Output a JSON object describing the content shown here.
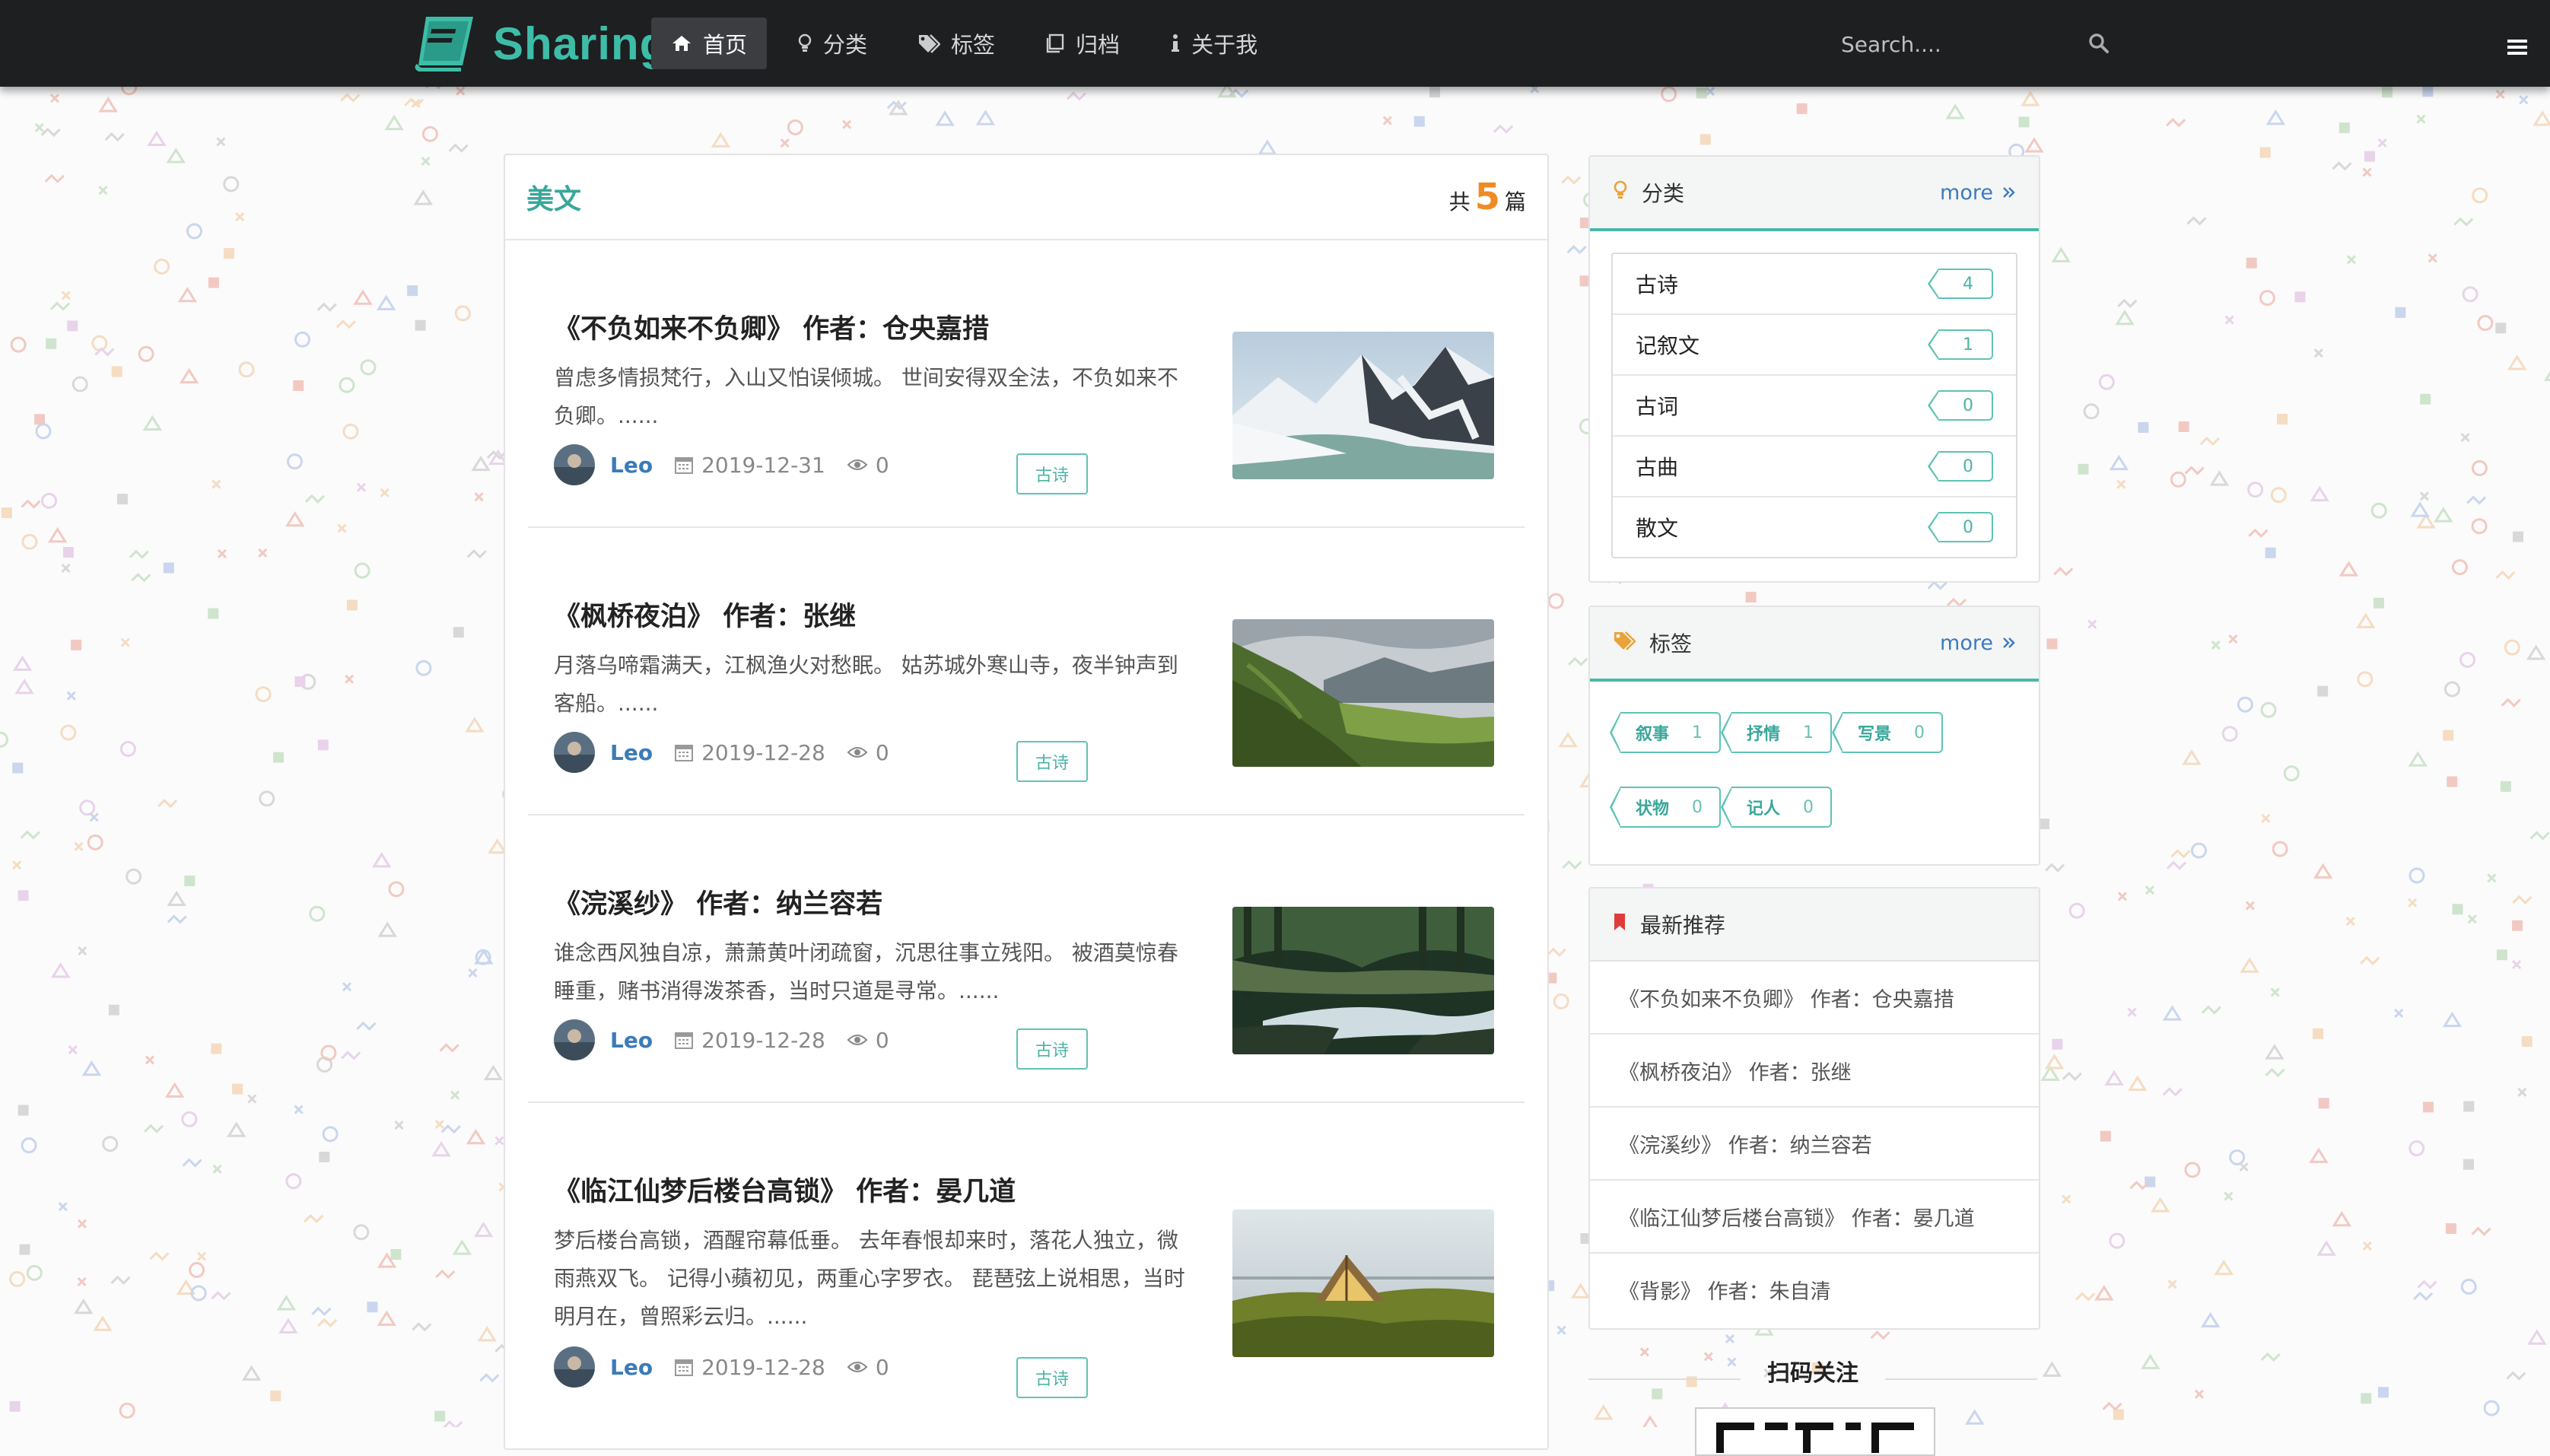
{
  "nav": {
    "brand": "Sharing",
    "items": [
      {
        "label": "首页",
        "icon": "home-icon",
        "active": true
      },
      {
        "label": "分类",
        "icon": "lightbulb-icon",
        "active": false
      },
      {
        "label": "标签",
        "icon": "tags-icon",
        "active": false
      },
      {
        "label": "归档",
        "icon": "archive-icon",
        "active": false
      },
      {
        "label": "关于我",
        "icon": "info-icon",
        "active": false
      }
    ],
    "search_placeholder": "Search...."
  },
  "main": {
    "title": "美文",
    "count_prefix": "共",
    "count": "5",
    "count_suffix": "篇",
    "articles": [
      {
        "title": "《不负如来不负卿》 作者：仓央嘉措",
        "excerpt": "曾虑多情损梵行，入山又怕误倾城。 世间安得双全法，不负如来不负卿。......",
        "author": "Leo",
        "date": "2019-12-31",
        "views": "0",
        "tag": "古诗",
        "image": "snow-mountain-photo"
      },
      {
        "title": "《枫桥夜泊》 作者：张继",
        "excerpt": "月落乌啼霜满天，江枫渔火对愁眠。 姑苏城外寒山寺，夜半钟声到客船。......",
        "author": "Leo",
        "date": "2019-12-28",
        "views": "0",
        "tag": "古诗",
        "image": "green-valley-photo"
      },
      {
        "title": "《浣溪纱》 作者：纳兰容若",
        "excerpt": "谁念西风独自凉，萧萧黄叶闭疏窗，沉思往事立残阳。 被酒莫惊春睡重，赌书消得泼茶香，当时只道是寻常。......",
        "author": "Leo",
        "date": "2019-12-28",
        "views": "0",
        "tag": "古诗",
        "image": "forest-stream-photo"
      },
      {
        "title": "《临江仙梦后楼台高锁》 作者：晏几道",
        "excerpt": "梦后楼台高锁，酒醒帘幕低垂。 去年春恨却来时，落花人独立，微雨燕双飞。 记得小蘋初见，两重心字罗衣。 琵琶弦上说相思，当时明月在，曾照彩云归。......",
        "author": "Leo",
        "date": "2019-12-28",
        "views": "0",
        "tag": "古诗",
        "image": "tent-photo"
      }
    ]
  },
  "sidebar": {
    "categories": {
      "title": "分类",
      "more": "more",
      "items": [
        {
          "name": "古诗",
          "count": "4"
        },
        {
          "name": "记叙文",
          "count": "1"
        },
        {
          "name": "古词",
          "count": "0"
        },
        {
          "name": "古曲",
          "count": "0"
        },
        {
          "name": "散文",
          "count": "0"
        }
      ]
    },
    "tags": {
      "title": "标签",
      "more": "more",
      "items": [
        {
          "name": "叙事",
          "count": "1"
        },
        {
          "name": "抒情",
          "count": "1"
        },
        {
          "name": "写景",
          "count": "0"
        },
        {
          "name": "状物",
          "count": "0"
        },
        {
          "name": "记人",
          "count": "0"
        }
      ]
    },
    "recommend": {
      "title": "最新推荐",
      "items": [
        "《不负如来不负卿》 作者：仓央嘉措",
        "《枫桥夜泊》 作者：张继",
        "《浣溪纱》 作者：纳兰容若",
        "《临江仙梦后楼台高锁》 作者：晏几道",
        "《背影》 作者：朱自清"
      ]
    },
    "qr_title": "扫码关注"
  },
  "colors": {
    "accent": "#3aa79a",
    "nav_bg": "#1d1f21",
    "count_orange": "#f08a24",
    "link_blue": "#3b7bb9"
  }
}
